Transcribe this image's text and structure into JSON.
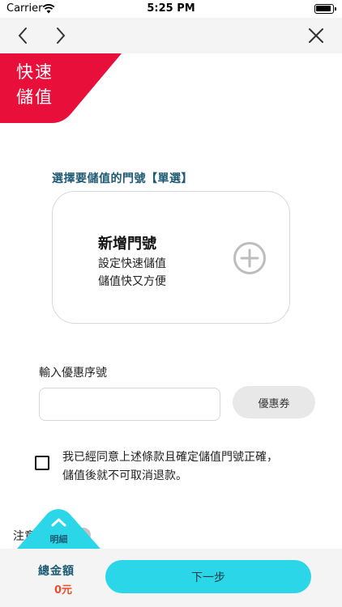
{
  "status_bar": {
    "carrier": "Carrier",
    "time": "5:25 PM"
  },
  "badge": {
    "line1": "快速",
    "line2": "儲值"
  },
  "door_section": {
    "label": "選擇要儲值的門號【單選】",
    "card_title": "新增門號",
    "card_line1": "設定快速儲值",
    "card_line2": "儲值快又方便"
  },
  "coupon": {
    "label": "輸入優惠序號",
    "input_value": "",
    "button_label": "優惠券"
  },
  "agreement": {
    "text": "我已經同意上述條款且確定儲值門號正確，儲值後就不可取消退款。",
    "checked": false
  },
  "notes": {
    "label": "注意事項"
  },
  "details_tab": {
    "label": "明細"
  },
  "footer": {
    "total_label": "總金額",
    "total_value": "0元",
    "next_button": "下一步"
  },
  "colors": {
    "accent_red": "#e8103a",
    "accent_cyan": "#2ad6e8",
    "label_blue": "#1d5a73",
    "amount_orange": "#e8502d"
  },
  "icons": [
    "wifi-icon",
    "battery-icon",
    "back-icon",
    "forward-icon",
    "close-icon",
    "plus-circle-icon",
    "chevron-up-icon",
    "checkbox-icon"
  ]
}
